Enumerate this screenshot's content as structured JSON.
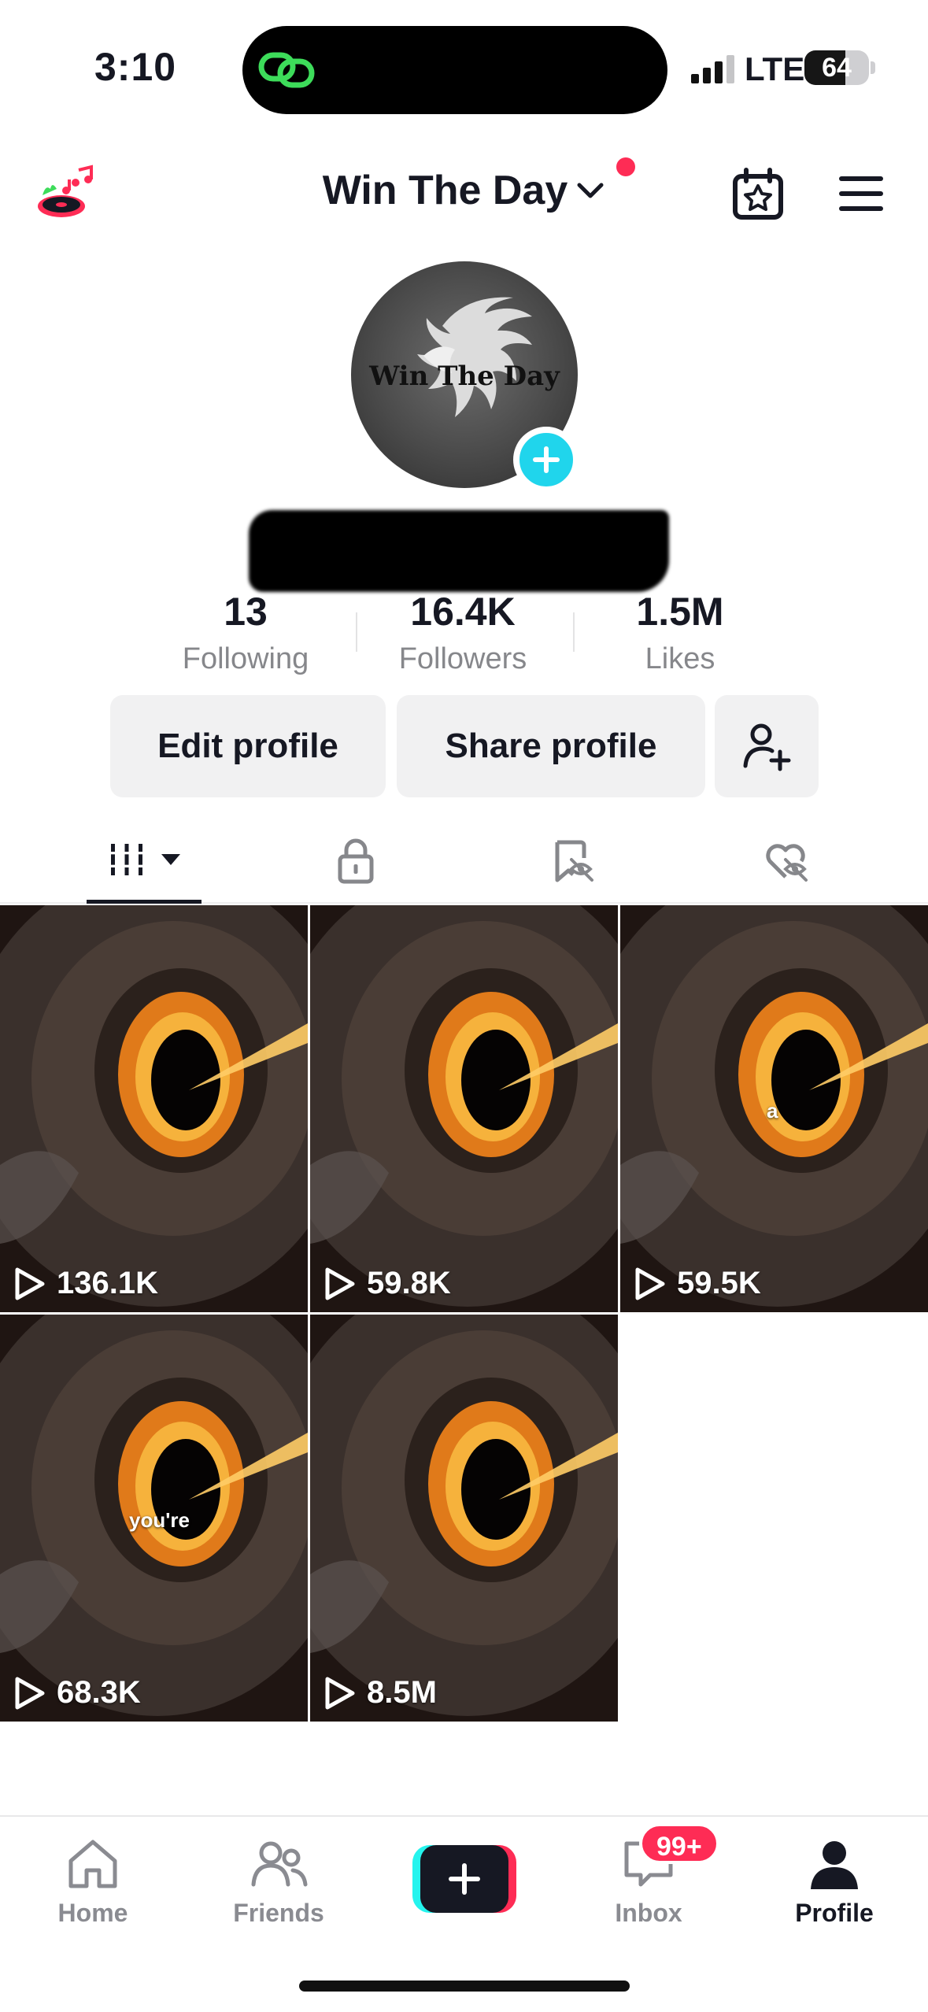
{
  "status_bar": {
    "time": "3:10",
    "network": "LTE",
    "battery": "64"
  },
  "header": {
    "title": "Win The Day"
  },
  "profile": {
    "avatar_text": "Win The Day",
    "stats": [
      {
        "value": "13",
        "label": "Following"
      },
      {
        "value": "16.4K",
        "label": "Followers"
      },
      {
        "value": "1.5M",
        "label": "Likes"
      }
    ]
  },
  "actions": {
    "edit": "Edit profile",
    "share": "Share profile"
  },
  "tabs": [
    "videos-tab-icon",
    "private-lock-icon",
    "favorites-hidden-icon",
    "liked-hidden-icon"
  ],
  "videos": [
    {
      "views": "136.1K",
      "caption": ""
    },
    {
      "views": "59.8K",
      "caption": ""
    },
    {
      "views": "59.5K",
      "caption": "a"
    },
    {
      "views": "68.3K",
      "caption": "you're"
    },
    {
      "views": "8.5M",
      "caption": ""
    }
  ],
  "nav": {
    "home": "Home",
    "friends": "Friends",
    "inbox": "Inbox",
    "inbox_badge": "99+",
    "profile": "Profile"
  },
  "colors": {
    "accent_pink": "#fe2c55",
    "accent_cyan": "#25f4ee",
    "plus_blue": "#20d5ec"
  }
}
